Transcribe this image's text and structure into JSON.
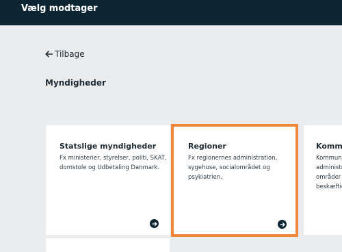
{
  "header": {
    "title": "Vælg modtager"
  },
  "navigation": {
    "back_label": "Tilbage"
  },
  "section": {
    "title": "Myndigheder"
  },
  "cards": [
    {
      "title": "Statslige myndigheder",
      "description": "Fx ministerier, styrelser, politi, SKAT, domstole og Udbetaling Danmark."
    },
    {
      "title": "Regioner",
      "description": "Fx regionernes administration, sygehuse, socialområdet og psykiatrien."
    },
    {
      "title": "Kommuner",
      "description": "Kommunernes administration, en række områder som skole, affald, beskæftigelse og handicap."
    }
  ],
  "icons": {
    "back": "arrow-left-icon",
    "card_action": "circle-arrow-right-icon"
  },
  "colors": {
    "header_bg": "#0d2532",
    "page_bg": "#ebeced",
    "card_bg": "#ffffff",
    "highlight": "#f0883a"
  }
}
